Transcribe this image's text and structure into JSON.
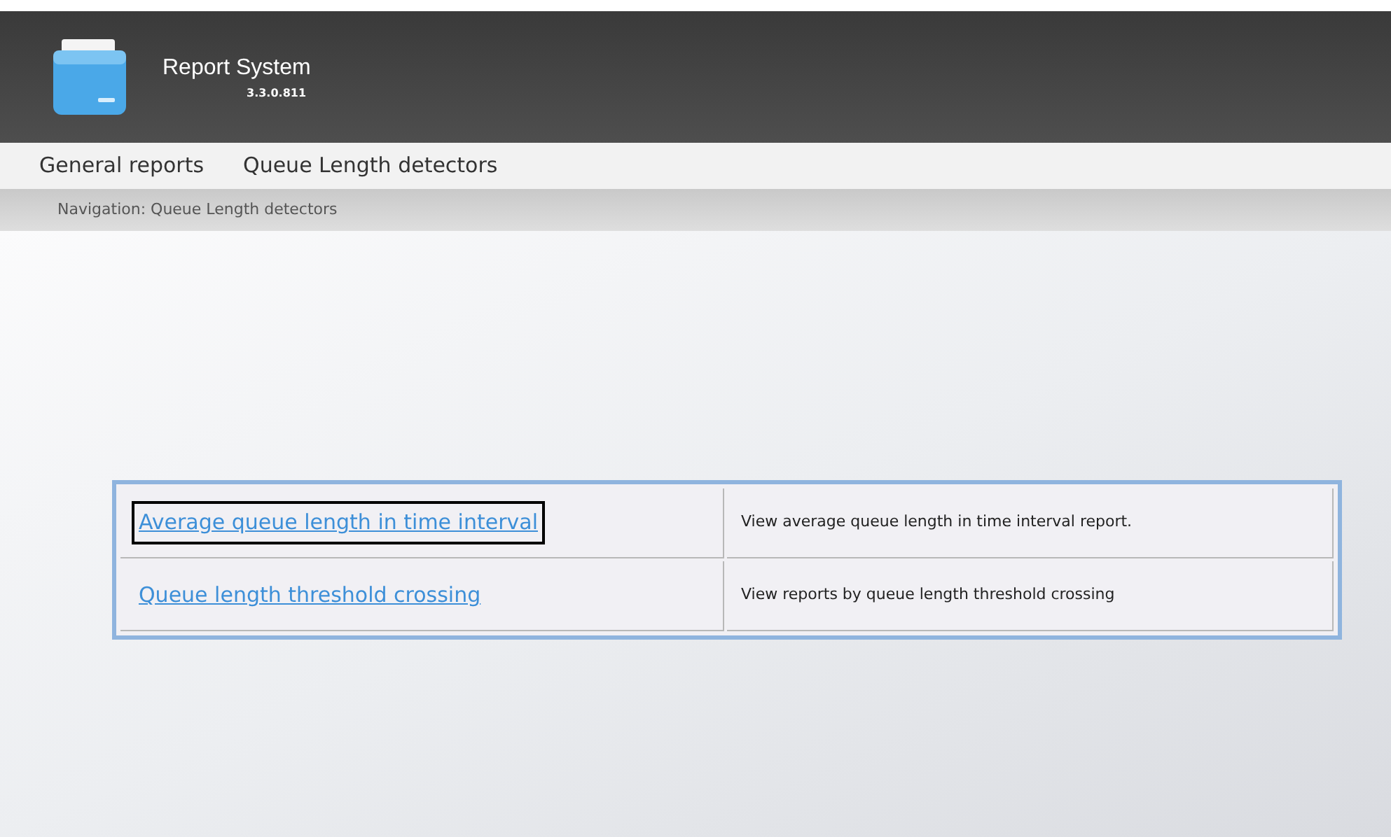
{
  "header": {
    "title": "Report System",
    "version": "3.3.0.811"
  },
  "menu": [
    {
      "label": "General reports"
    },
    {
      "label": "Queue Length detectors"
    }
  ],
  "navigation": "Navigation: Queue Length detectors",
  "reports": [
    {
      "link": "Average queue length in time interval",
      "description": "View average queue length in time interval report.",
      "highlighted": true
    },
    {
      "link": "Queue length threshold crossing",
      "description": "View reports by queue length threshold crossing",
      "highlighted": false
    }
  ]
}
